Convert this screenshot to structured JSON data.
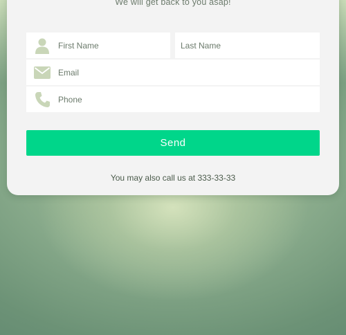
{
  "form": {
    "subtitle": "We will get back to you asap!",
    "fields": {
      "first_name_placeholder": "First Name",
      "last_name_placeholder": "Last Name",
      "email_placeholder": "Email",
      "phone_placeholder": "Phone"
    },
    "send_label": "Send",
    "call_text": "You may also call us at 333-33-33"
  },
  "icons": {
    "first_name": "user-icon",
    "email": "envelope-icon",
    "phone": "phone-icon"
  },
  "colors": {
    "accent": "#00d68a",
    "card": "#f3f3f3",
    "icon": "#c9d6b8",
    "text": "#6b7a6b"
  }
}
